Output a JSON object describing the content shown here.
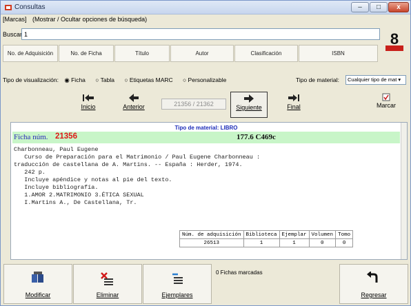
{
  "window": {
    "title": "Consultas"
  },
  "menu": {
    "items": [
      "[Marcas]",
      "(Mostrar / Ocultar opciones de búsqueda)"
    ]
  },
  "search": {
    "label": "Buscar:",
    "value": "1"
  },
  "fields": [
    "No. de Adquisición",
    "No. de Ficha",
    "Título",
    "Autor",
    "Clasificación",
    "ISBN"
  ],
  "view": {
    "label": "Tipo de visualización:",
    "options": [
      "Ficha",
      "Tabla",
      "Etiquetas MARC",
      "Personalizable"
    ],
    "selected": "Ficha",
    "material_label": "Tipo de material:",
    "material_value": "Cualquier tipo de mat"
  },
  "nav": {
    "first": "Inicio",
    "prev": "Anterior",
    "counter": "21356 / 21362",
    "next": "Siguiente",
    "last": "Final",
    "mark": "Marcar"
  },
  "record": {
    "material_type": "Tipo de material: LIBRO",
    "ficha_label": "Ficha núm.",
    "ficha_num": "21356",
    "call_number": "177.6 C469c",
    "lines": [
      "Charbonneau, Paul Eugene",
      "   Curso de Preparación para el Matrimonio / Paul Eugene Charbonneau :",
      "traducción de castellana de A. Martins. -- España : Herder, 1974.",
      "   242 p.",
      "   Incluye apéndice y notas al pie del texto.",
      "   Incluye bibliografía.",
      "   1.AMOR 2.MATRIMONIO 3.ÉTICA SEXUAL",
      "   I.Martins A., De Castellana, Tr."
    ],
    "holdings": {
      "headers": [
        "Núm. de adquisición",
        "Biblioteca",
        "Ejemplar",
        "Volumen",
        "Tomo"
      ],
      "row": [
        "26513",
        "1",
        "1",
        "0",
        "0"
      ]
    }
  },
  "bottom": {
    "modify": "Modificar",
    "delete": "Eliminar",
    "copies": "Ejemplares",
    "marked": "0 Fichas marcadas",
    "back": "Regresar"
  },
  "colors": {
    "record_band": "#c8f5c8",
    "ficha_num": "#e01818",
    "material_type": "#1b2bb8"
  }
}
